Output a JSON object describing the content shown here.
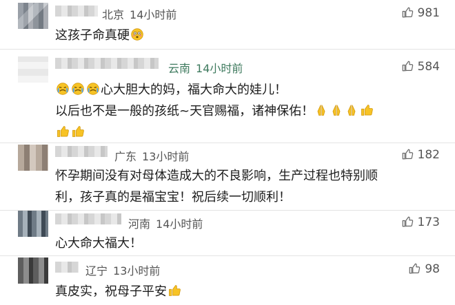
{
  "comments": [
    {
      "location": "北京",
      "time": "14小时前",
      "likes": "981",
      "lines": [
        "这孩子命真硬"
      ],
      "trailing_emoji": [
        "flushed-face-icon"
      ]
    },
    {
      "location": "云南",
      "time": "14小时前",
      "likes": "584",
      "leading_emoji": [
        "crying-face-icon",
        "crying-face-icon",
        "crying-face-icon"
      ],
      "lines": [
        "心大胆大的妈，福大命大的娃儿！",
        "以后也不是一般的孩纸~天官赐福，诸神保佑！"
      ],
      "line2_emoji": [
        "praying-hands-icon",
        "praying-hands-icon",
        "praying-hands-icon",
        "thumbs-up-icon"
      ],
      "line3_emoji": [
        "thumbs-up-icon",
        "thumbs-up-icon"
      ]
    },
    {
      "location": "广东",
      "time": "13小时前",
      "likes": "182",
      "lines": [
        "怀孕期间没有对母体造成大的不良影响，生产过程也特别顺",
        "利，孩子真的是福宝宝！祝后续一切顺利！"
      ]
    },
    {
      "location": "河南",
      "time": "14小时前",
      "likes": "173",
      "lines": [
        "心大命大福大！"
      ]
    },
    {
      "location": "辽宁",
      "time": "13小时前",
      "likes": "98",
      "lines": [
        "真皮实，祝母子平安"
      ],
      "trailing_emoji": [
        "thumbs-up-icon"
      ]
    }
  ],
  "colors": {
    "text": "#1c1c1c",
    "meta": "#555555",
    "location_accent": "#3e7a5e",
    "divider": "#e3e3e3",
    "emoji_yellow": "#f7c325"
  }
}
